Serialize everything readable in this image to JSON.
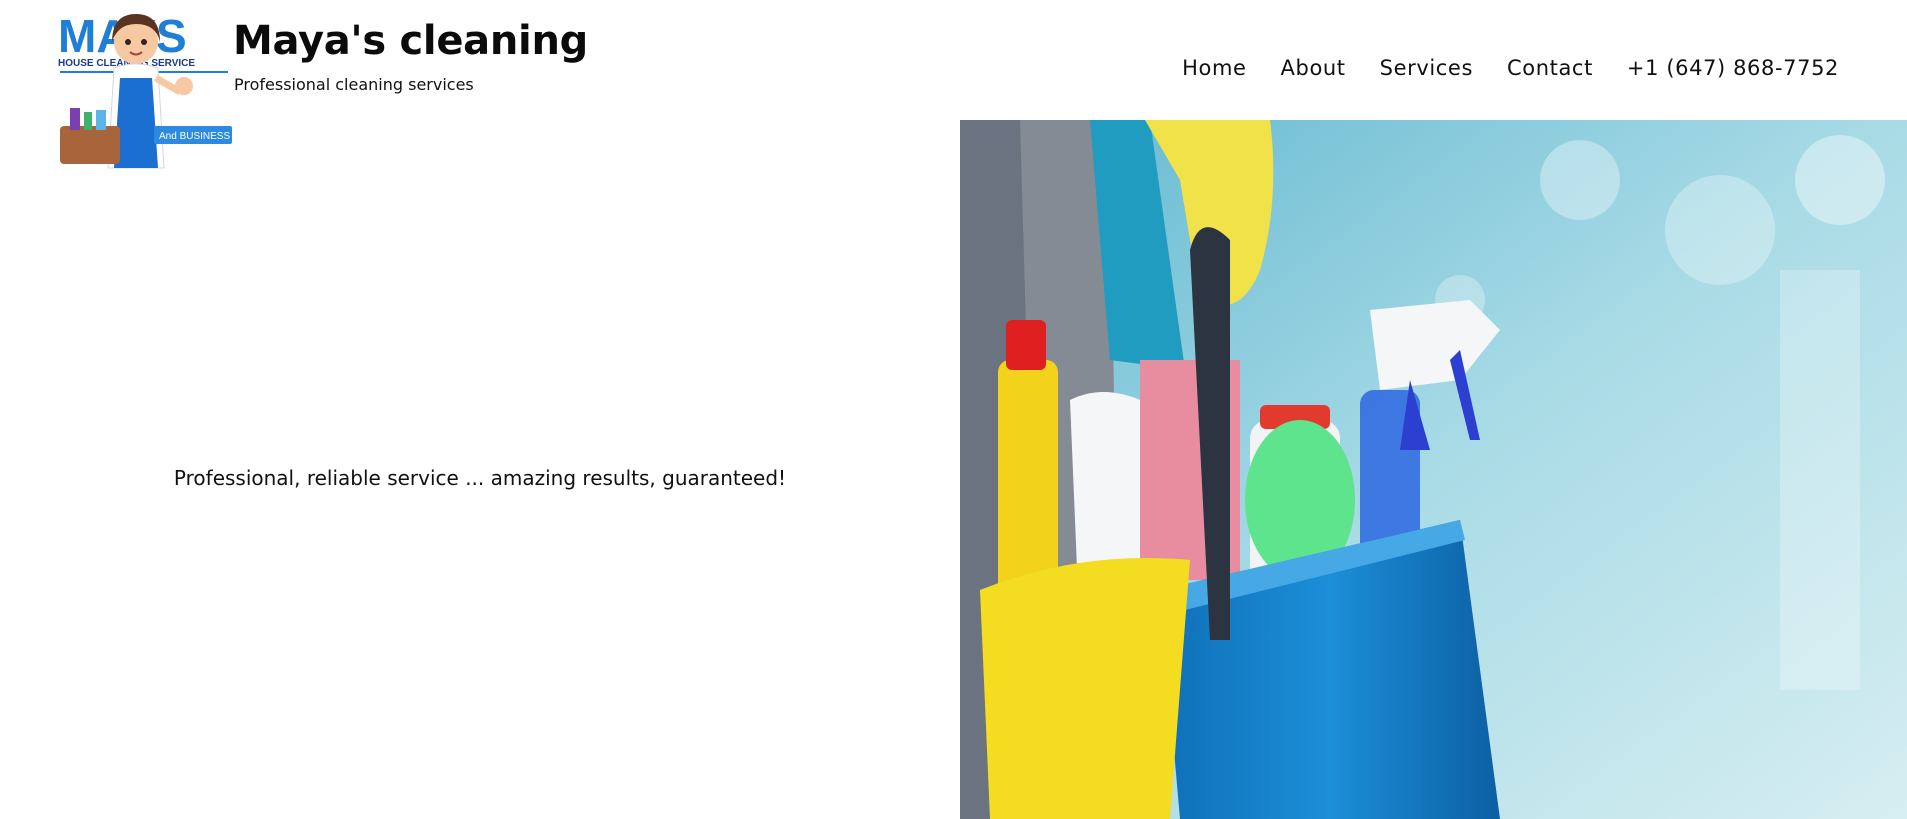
{
  "header": {
    "logo": {
      "brand_text": "MAYS",
      "sub_text": "HOUSE CLEANING SERVICE",
      "badge_text": "And BUSINESS"
    },
    "title": "Maya's cleaning",
    "tagline": "Professional cleaning services"
  },
  "nav": {
    "items": [
      {
        "label": "Home"
      },
      {
        "label": "About"
      },
      {
        "label": "Services"
      },
      {
        "label": "Contact"
      },
      {
        "label": "+1 (647) 868-7752"
      }
    ]
  },
  "hero": {
    "text": "Professional, reliable service ... amazing results, guaranteed!",
    "image_subject": "cleaning supplies in blue bucket"
  },
  "colors": {
    "brand_blue": "#1f7fd6",
    "bucket_blue": "#1687d0",
    "yellow": "#f2d21a",
    "background": "#ffffff"
  }
}
